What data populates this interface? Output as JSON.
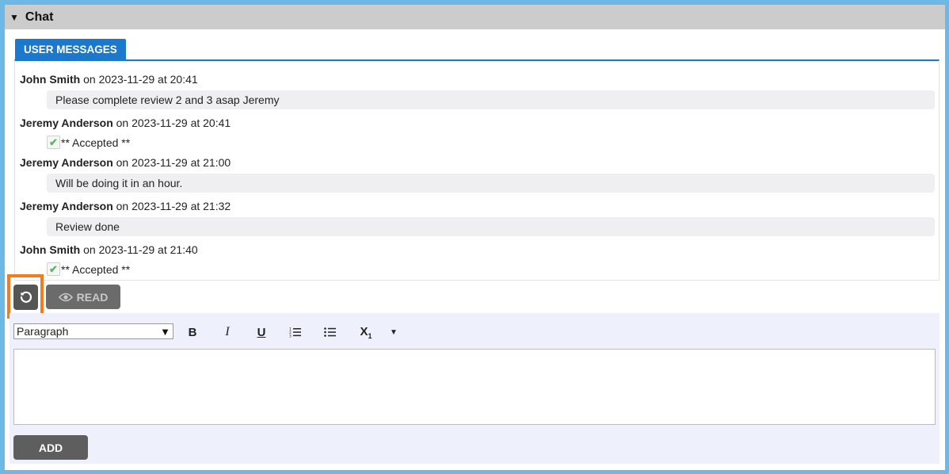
{
  "panel": {
    "title": "Chat"
  },
  "tab": {
    "label": "USER MESSAGES"
  },
  "messages": [
    {
      "author": "John Smith",
      "meta": " on 2023-11-29 at 20:41",
      "text": "Please complete review 2 and 3 asap Jeremy",
      "accepted": false
    },
    {
      "author": "Jeremy Anderson",
      "meta": " on 2023-11-29 at 20:41",
      "text": "** Accepted **",
      "accepted": true
    },
    {
      "author": "Jeremy Anderson",
      "meta": " on 2023-11-29 at 21:00",
      "text": "Will be doing it in an hour.",
      "accepted": false
    },
    {
      "author": "Jeremy Anderson",
      "meta": " on 2023-11-29 at 21:32",
      "text": "Review done",
      "accepted": false
    },
    {
      "author": "John Smith",
      "meta": " on 2023-11-29 at 21:40",
      "text": "** Accepted **",
      "accepted": true
    }
  ],
  "actions": {
    "read_label": "READ",
    "add_label": "ADD"
  },
  "editor": {
    "format_value": "Paragraph",
    "tools": [
      "B",
      "I",
      "U"
    ],
    "subscript_label": "X",
    "subscript_sub": "1"
  },
  "colors": {
    "accent": "#1b78cd",
    "highlight": "#f07d22",
    "check": "#5cb85c"
  }
}
